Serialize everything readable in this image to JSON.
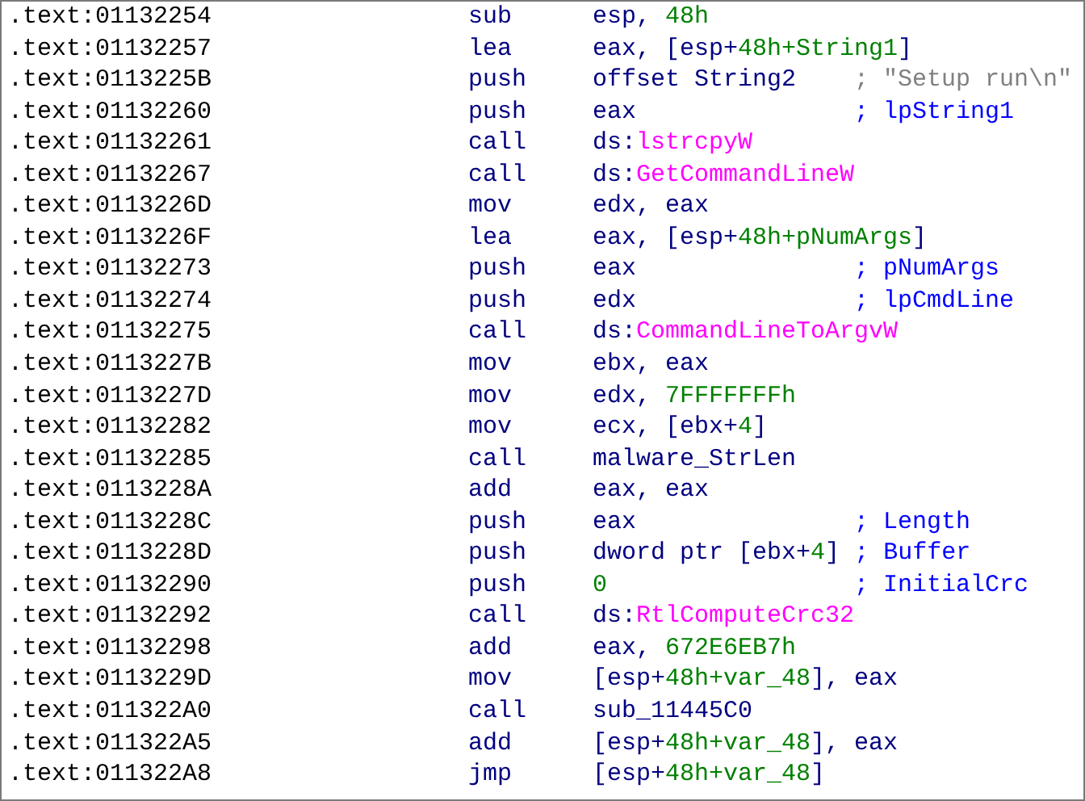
{
  "listing": [
    {
      "address": ".text:01132254",
      "mnemonic": "sub",
      "operand": [
        {
          "kind": "text",
          "t": "esp, "
        },
        {
          "kind": "num",
          "t": "48h"
        }
      ]
    },
    {
      "address": ".text:01132257",
      "mnemonic": "lea",
      "operand": [
        {
          "kind": "text",
          "t": "eax, [esp+"
        },
        {
          "kind": "num",
          "t": "48h+String1"
        },
        {
          "kind": "text",
          "t": "]"
        }
      ]
    },
    {
      "address": ".text:0113225B",
      "mnemonic": "push",
      "operand": [
        {
          "kind": "text",
          "t": "offset String2"
        }
      ],
      "comment": {
        "kind": "string",
        "t": "; \"Setup run\\n\""
      }
    },
    {
      "address": ".text:01132260",
      "mnemonic": "push",
      "operand": [
        {
          "kind": "text",
          "t": "eax"
        }
      ],
      "comment": {
        "kind": "auto",
        "t": "; lpString1"
      }
    },
    {
      "address": ".text:01132261",
      "mnemonic": "call",
      "operand": [
        {
          "kind": "text",
          "t": "ds:"
        },
        {
          "kind": "import",
          "t": "lstrcpyW"
        }
      ]
    },
    {
      "address": ".text:01132267",
      "mnemonic": "call",
      "operand": [
        {
          "kind": "text",
          "t": "ds:"
        },
        {
          "kind": "import",
          "t": "GetCommandLineW"
        }
      ]
    },
    {
      "address": ".text:0113226D",
      "mnemonic": "mov",
      "operand": [
        {
          "kind": "text",
          "t": "edx, eax"
        }
      ]
    },
    {
      "address": ".text:0113226F",
      "mnemonic": "lea",
      "operand": [
        {
          "kind": "text",
          "t": "eax, [esp+"
        },
        {
          "kind": "num",
          "t": "48h+pNumArgs"
        },
        {
          "kind": "text",
          "t": "]"
        }
      ]
    },
    {
      "address": ".text:01132273",
      "mnemonic": "push",
      "operand": [
        {
          "kind": "text",
          "t": "eax"
        }
      ],
      "comment": {
        "kind": "auto",
        "t": "; pNumArgs"
      }
    },
    {
      "address": ".text:01132274",
      "mnemonic": "push",
      "operand": [
        {
          "kind": "text",
          "t": "edx"
        }
      ],
      "comment": {
        "kind": "auto",
        "t": "; lpCmdLine"
      }
    },
    {
      "address": ".text:01132275",
      "mnemonic": "call",
      "operand": [
        {
          "kind": "text",
          "t": "ds:"
        },
        {
          "kind": "import",
          "t": "CommandLineToArgvW"
        }
      ]
    },
    {
      "address": ".text:0113227B",
      "mnemonic": "mov",
      "operand": [
        {
          "kind": "text",
          "t": "ebx, eax"
        }
      ]
    },
    {
      "address": ".text:0113227D",
      "mnemonic": "mov",
      "operand": [
        {
          "kind": "text",
          "t": "edx, "
        },
        {
          "kind": "num",
          "t": "7FFFFFFFh"
        }
      ]
    },
    {
      "address": ".text:01132282",
      "mnemonic": "mov",
      "operand": [
        {
          "kind": "text",
          "t": "ecx, [ebx+"
        },
        {
          "kind": "num",
          "t": "4"
        },
        {
          "kind": "text",
          "t": "]"
        }
      ]
    },
    {
      "address": ".text:01132285",
      "mnemonic": "call",
      "operand": [
        {
          "kind": "text",
          "t": "malware_StrLen"
        }
      ]
    },
    {
      "address": ".text:0113228A",
      "mnemonic": "add",
      "operand": [
        {
          "kind": "text",
          "t": "eax, eax"
        }
      ]
    },
    {
      "address": ".text:0113228C",
      "mnemonic": "push",
      "operand": [
        {
          "kind": "text",
          "t": "eax"
        }
      ],
      "comment": {
        "kind": "auto",
        "t": "; Length"
      }
    },
    {
      "address": ".text:0113228D",
      "mnemonic": "push",
      "operand": [
        {
          "kind": "text",
          "t": "dword ptr [ebx+"
        },
        {
          "kind": "num",
          "t": "4"
        },
        {
          "kind": "text",
          "t": "]"
        }
      ],
      "comment": {
        "kind": "auto",
        "t": "; Buffer"
      }
    },
    {
      "address": ".text:01132290",
      "mnemonic": "push",
      "operand": [
        {
          "kind": "num",
          "t": "0"
        }
      ],
      "comment": {
        "kind": "auto",
        "t": "; InitialCrc"
      }
    },
    {
      "address": ".text:01132292",
      "mnemonic": "call",
      "operand": [
        {
          "kind": "text",
          "t": "ds:"
        },
        {
          "kind": "import",
          "t": "RtlComputeCrc32"
        }
      ]
    },
    {
      "address": ".text:01132298",
      "mnemonic": "add",
      "operand": [
        {
          "kind": "text",
          "t": "eax, "
        },
        {
          "kind": "num",
          "t": "672E6EB7h"
        }
      ]
    },
    {
      "address": ".text:0113229D",
      "mnemonic": "mov",
      "operand": [
        {
          "kind": "text",
          "t": "[esp+"
        },
        {
          "kind": "num",
          "t": "48h+var_48"
        },
        {
          "kind": "text",
          "t": "], eax"
        }
      ]
    },
    {
      "address": ".text:011322A0",
      "mnemonic": "call",
      "operand": [
        {
          "kind": "text",
          "t": "sub_11445C0"
        }
      ]
    },
    {
      "address": ".text:011322A5",
      "mnemonic": "add",
      "operand": [
        {
          "kind": "text",
          "t": "[esp+"
        },
        {
          "kind": "num",
          "t": "48h+var_48"
        },
        {
          "kind": "text",
          "t": "], eax"
        }
      ]
    },
    {
      "address": ".text:011322A8",
      "mnemonic": "jmp",
      "operand": [
        {
          "kind": "text",
          "t": "[esp+"
        },
        {
          "kind": "num",
          "t": "48h+var_48"
        },
        {
          "kind": "text",
          "t": "]"
        }
      ]
    }
  ]
}
